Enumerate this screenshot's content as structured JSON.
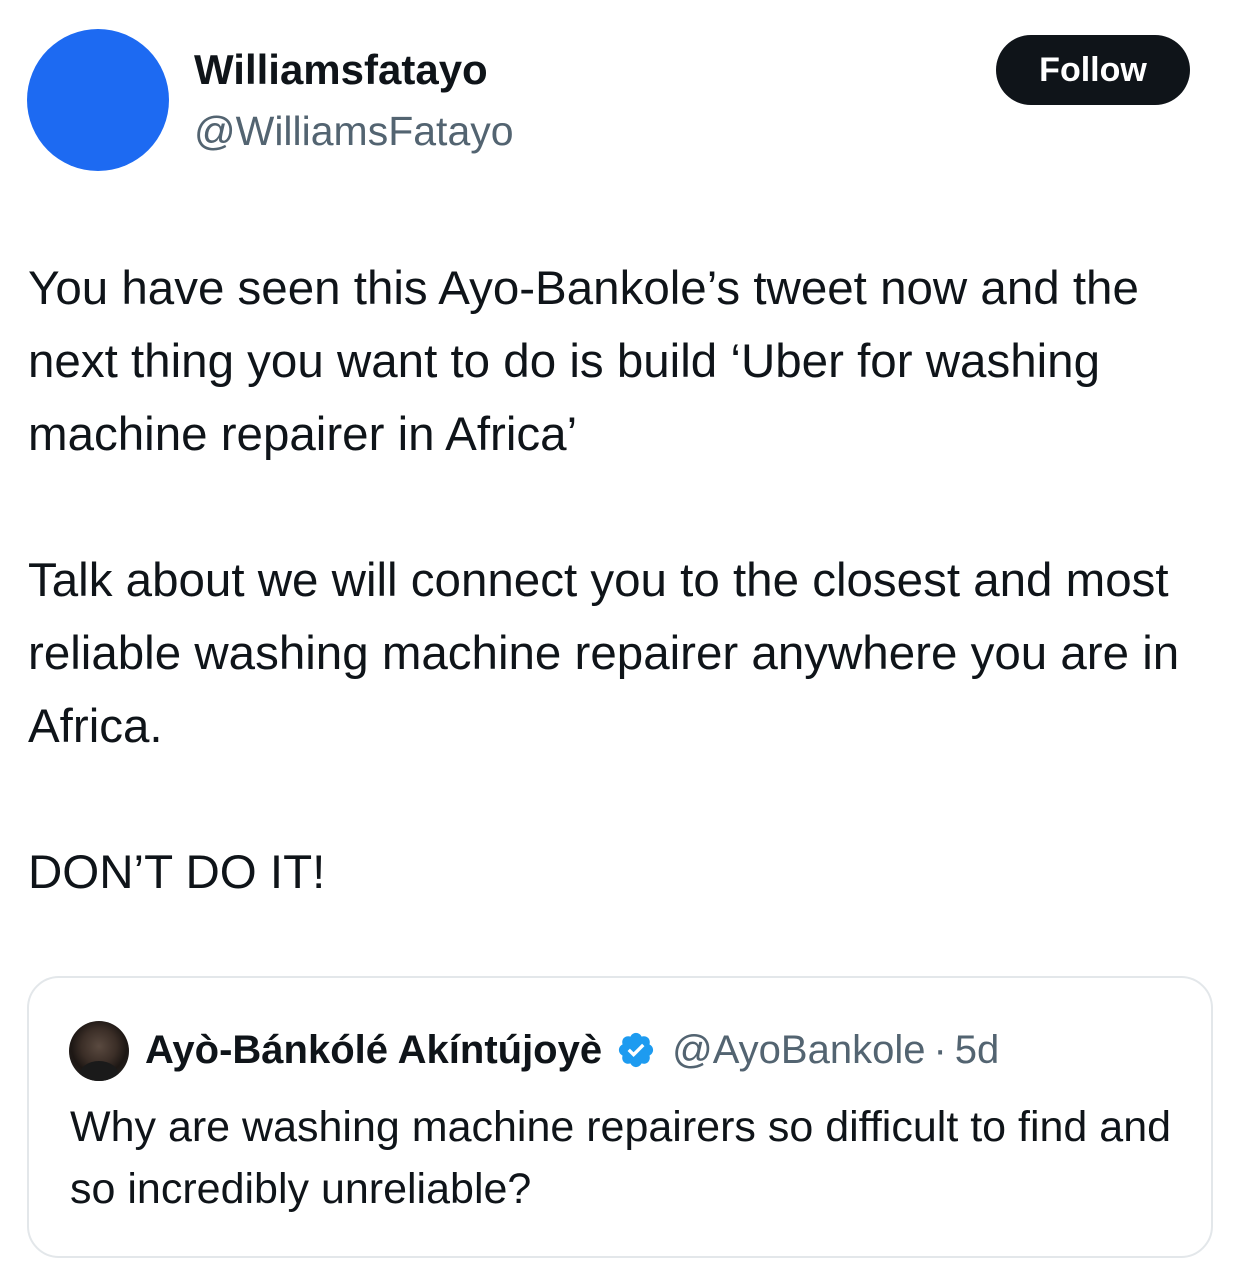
{
  "author": {
    "display_name": "Williamsfatayo",
    "handle": "@WilliamsFatayo",
    "avatar_color": "#1d6af2"
  },
  "follow_button": {
    "label": "Follow"
  },
  "tweet": {
    "paragraphs": [
      "You have seen this Ayo-Bankole’s tweet now and the next thing you want to do is build ‘Uber for washing machine repairer in Africa’",
      "Talk about we will connect you to the closest and most reliable washing machine repairer anywhere you are in Africa.",
      "DON’T DO IT!"
    ]
  },
  "quoted_tweet": {
    "display_name": "Ayò-Bánkólé Akíntújoyè",
    "verified_icon": "verified-badge-icon",
    "verified_color": "#1d9bf0",
    "handle": "@AyoBankole",
    "separator": "·",
    "time": "5d",
    "text": "Why are washing machine repairers so difficult to find and so incredibly unreliable?"
  }
}
